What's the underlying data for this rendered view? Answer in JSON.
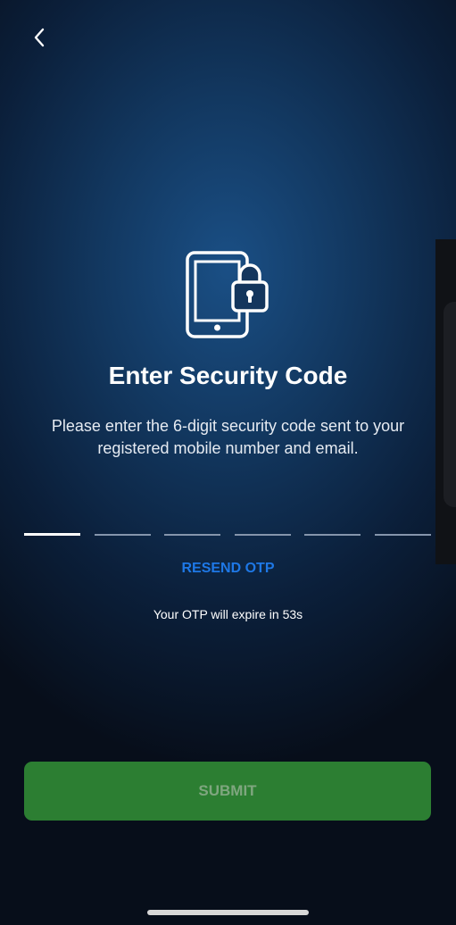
{
  "header": {
    "back_icon": "chevron-left-icon"
  },
  "hero": {
    "icon": "tablet-lock-icon",
    "title": "Enter Security Code",
    "subtitle": "Please enter the 6-digit security code sent to your registered mobile number and email."
  },
  "otp": {
    "digits": [
      "",
      "",
      "",
      "",
      "",
      ""
    ],
    "active_index": 0
  },
  "resend_label": "RESEND OTP",
  "expiry_text": "Your OTP will expire in 53s",
  "submit_label": "SUBMIT",
  "colors": {
    "accent_link": "#1e78e6",
    "submit_bg": "#2c7e32",
    "submit_text": "#7fa67f"
  }
}
